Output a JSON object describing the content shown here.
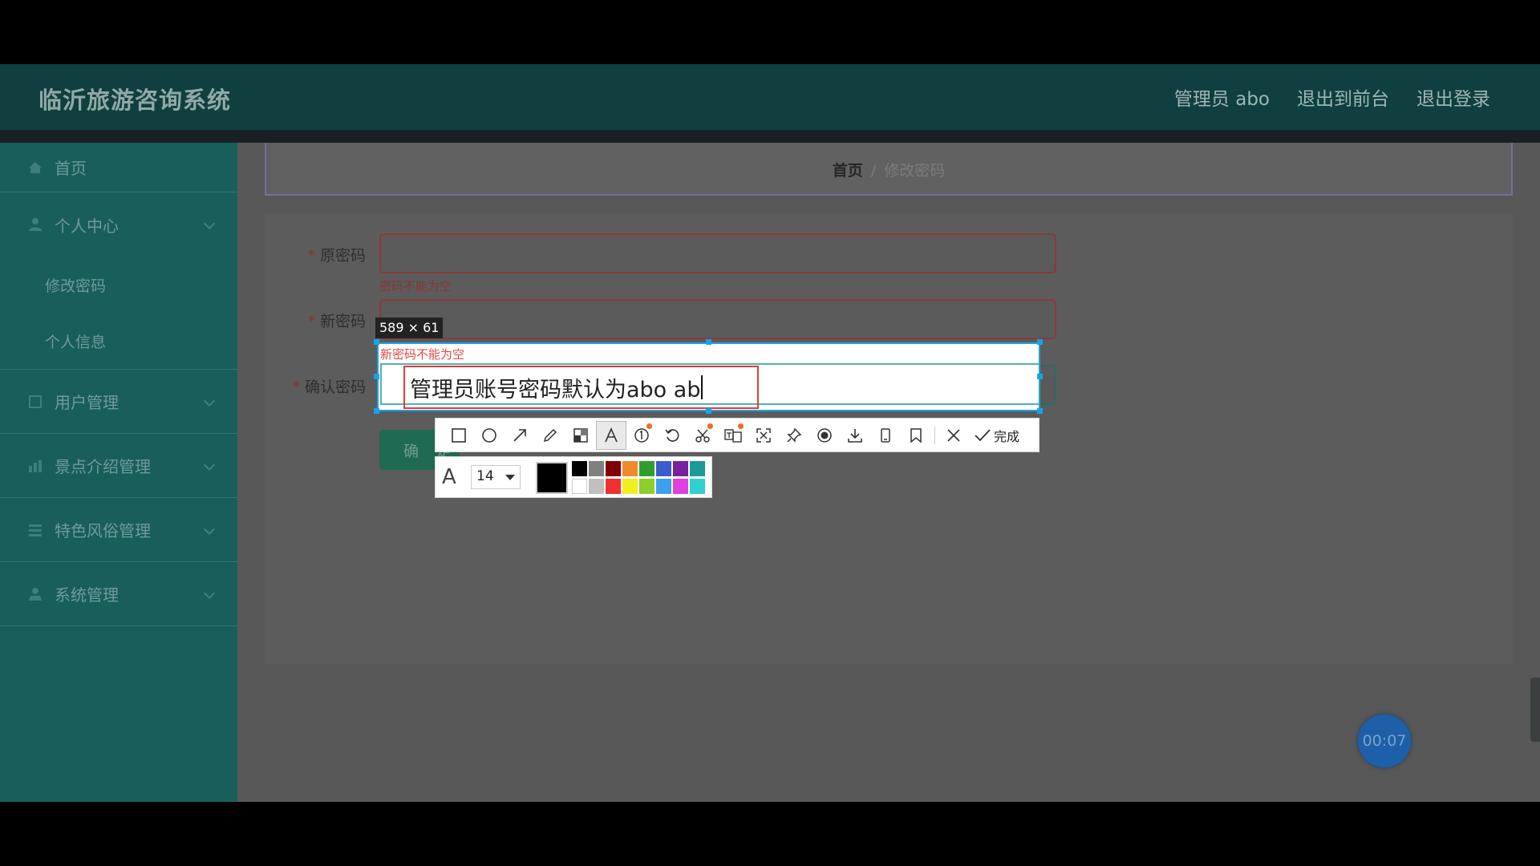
{
  "header": {
    "app_title": "临沂旅游咨询系统",
    "links": [
      "管理员 abo",
      "退出到前台",
      "退出登录"
    ]
  },
  "sidebar": {
    "home": {
      "label": "首页",
      "icon": "home-icon"
    },
    "groups": [
      {
        "label": "个人中心",
        "icon": "user-icon",
        "children": [
          "修改密码",
          "个人信息"
        ]
      },
      {
        "label": "用户管理",
        "icon": "square-icon"
      },
      {
        "label": "景点介绍管理",
        "icon": "chart-icon"
      },
      {
        "label": "特色风俗管理",
        "icon": "list-icon"
      },
      {
        "label": "系统管理",
        "icon": "user-admin-icon"
      }
    ]
  },
  "breadcrumb": {
    "home": "首页",
    "separator": "/",
    "current": "修改密码"
  },
  "form": {
    "fields": [
      {
        "label": "原密码",
        "required": "*",
        "error": "密码不能为空"
      },
      {
        "label": "新密码",
        "required": "*",
        "error": "新密码不能为空"
      },
      {
        "label": "确认密码",
        "required": "*"
      }
    ],
    "submit_label": "确 定"
  },
  "capture_overlay": {
    "selection_size": "589 × 61",
    "error_text": "新密码不能为空",
    "annotation_text": "管理员账号密码默认为abo ab",
    "toolbar_done_label": "完成",
    "font_size": "14",
    "current_color": "#000000",
    "swatches": [
      "#000000",
      "#808080",
      "#800000",
      "#f08a2c",
      "#2f9e2f",
      "#3b5ccc",
      "#7a1f9e",
      "#1a9a9a",
      "#ffffff",
      "#c0c0c0",
      "#f03030",
      "#f0f020",
      "#8ccf2a",
      "#3ea0f0",
      "#e040e0",
      "#30d0d0"
    ]
  },
  "timer": "00:07"
}
